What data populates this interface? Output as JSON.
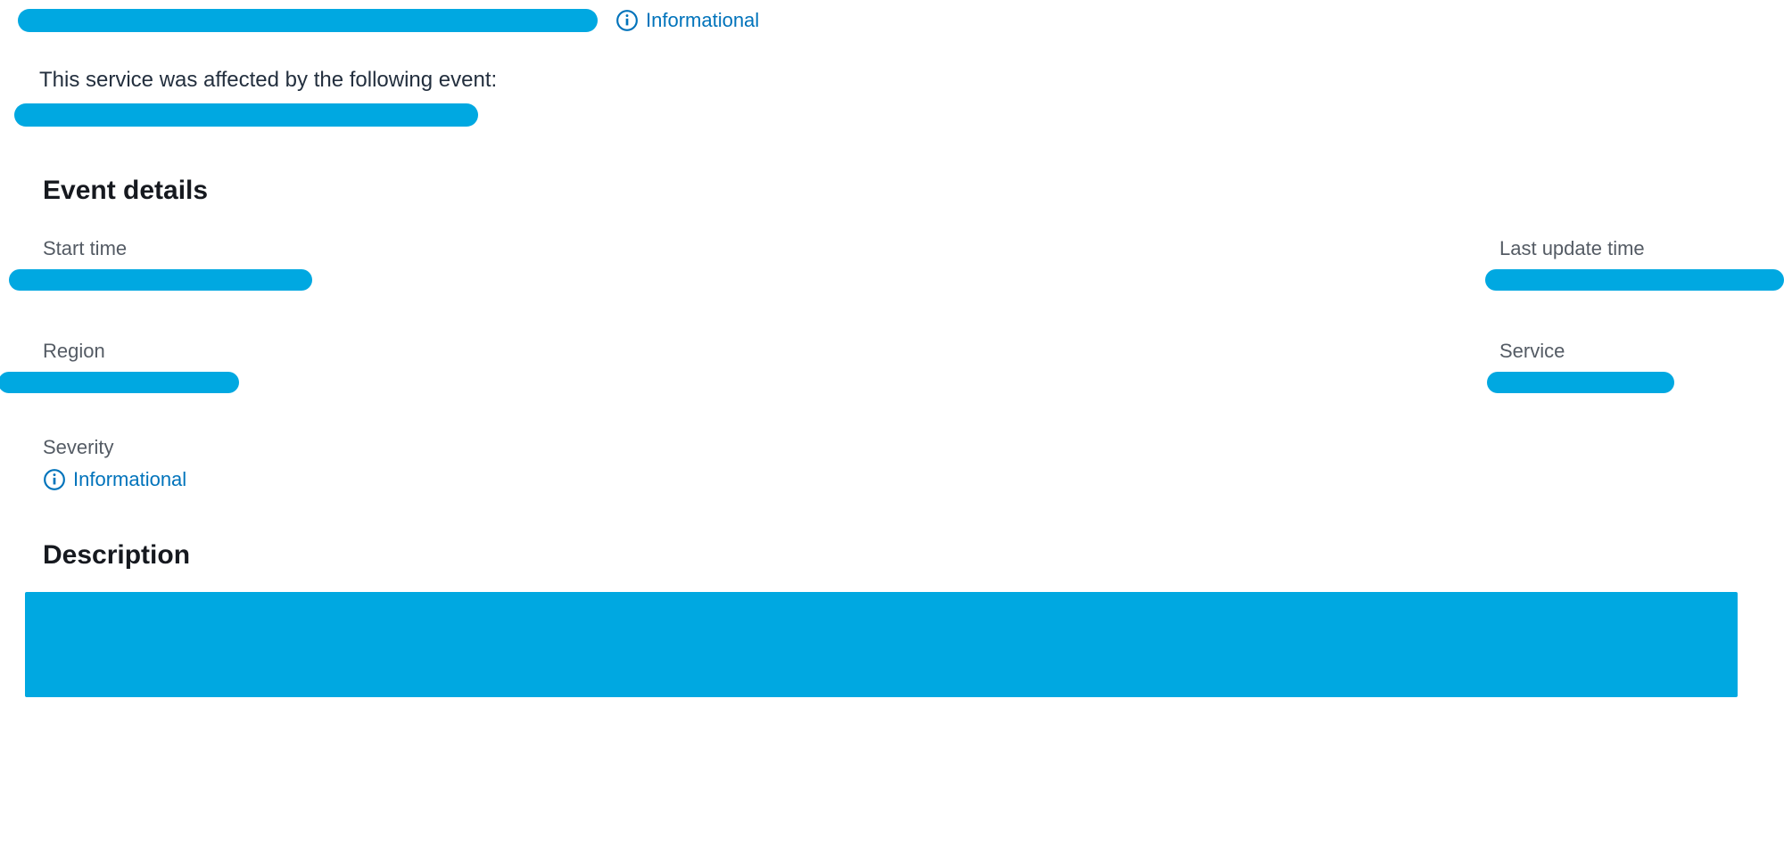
{
  "header": {
    "severity_badge": "Informational"
  },
  "affected": {
    "text": "This service was affected by the following event:"
  },
  "sections": {
    "event_details_title": "Event details",
    "description_title": "Description"
  },
  "fields": {
    "start_time": {
      "label": "Start time"
    },
    "last_update_time": {
      "label": "Last update time"
    },
    "region": {
      "label": "Region"
    },
    "service": {
      "label": "Service"
    },
    "severity": {
      "label": "Severity",
      "value": "Informational"
    }
  },
  "colors": {
    "redaction": "#00a8e1",
    "link": "#0073bb",
    "text_primary": "#16191f",
    "text_secondary": "#545b64"
  }
}
